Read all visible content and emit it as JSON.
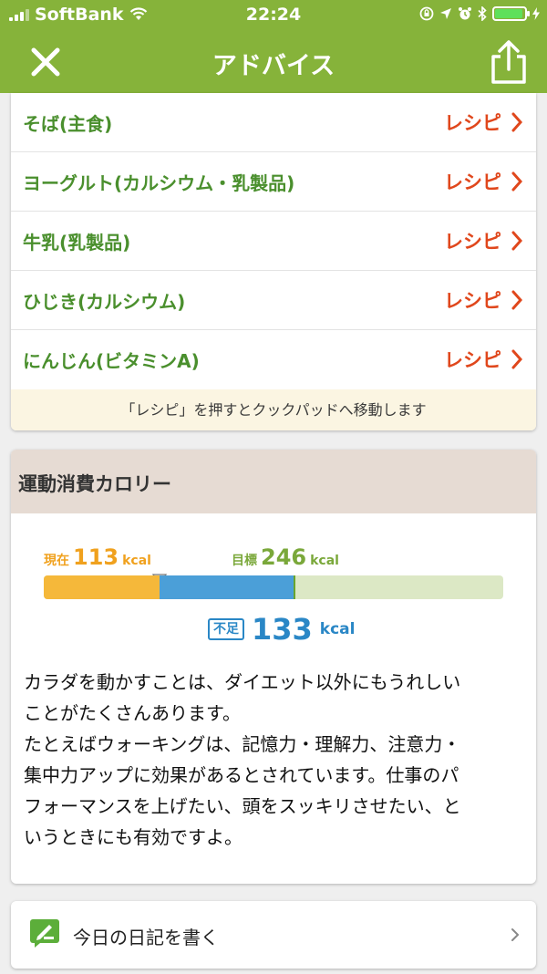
{
  "status": {
    "carrier": "SoftBank",
    "time": "22:24"
  },
  "nav": {
    "title": "アドバイス"
  },
  "foods": [
    {
      "label": "そば(主食)",
      "action": "レシピ"
    },
    {
      "label": "ヨーグルト(カルシウム・乳製品)",
      "action": "レシピ"
    },
    {
      "label": "牛乳(乳製品)",
      "action": "レシピ"
    },
    {
      "label": "ひじき(カルシウム)",
      "action": "レシピ"
    },
    {
      "label": "にんじん(ビタミンA)",
      "action": "レシピ"
    }
  ],
  "foods_note": "「レシピ」を押すとクックパッドへ移動します",
  "exercise": {
    "title": "運動消費カロリー",
    "current_label": "現在",
    "current_value": "113",
    "target_label": "目標",
    "target_value": "246",
    "unit": "kcal",
    "shortfall_label": "不足",
    "shortfall_value": "133",
    "progress": {
      "current": 113,
      "target": 246
    },
    "advice_lines": [
      "カラダを動かすことは、ダイエット以外にもうれしい",
      "ことがたくさんあります。",
      "たとえばウォーキングは、記憶力・理解力、注意力・",
      "集中力アップに効果があるとされています。仕事のパ",
      "フォーマンスを上げたい、頭をスッキリさせたい、と",
      "いうときにも有効ですよ。"
    ]
  },
  "diary": {
    "label": "今日の日記を書く"
  },
  "colors": {
    "header": "#86b33a",
    "food_text": "#4a8f2d",
    "recipe": "#e0471c",
    "current": "#f5b83a",
    "shortfall": "#4b9fd8",
    "target_bg": "#dce8c5"
  }
}
